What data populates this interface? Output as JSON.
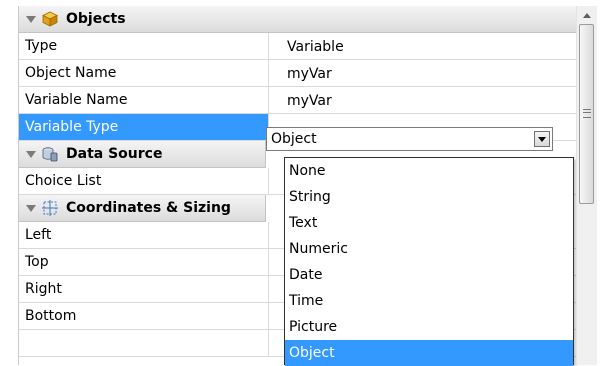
{
  "groups": {
    "objects": {
      "label": "Objects",
      "icon": "cube-icon"
    },
    "data_source": {
      "label": "Data Source",
      "icon": "database-icon"
    },
    "coordinates": {
      "label": "Coordinates & Sizing",
      "icon": "coordinates-grid-icon"
    }
  },
  "properties": {
    "type": {
      "name": "Type",
      "value": "Variable"
    },
    "object_name": {
      "name": "Object Name",
      "value": "myVar"
    },
    "variable_name": {
      "name": "Variable Name",
      "value": "myVar"
    },
    "variable_type": {
      "name": "Variable Type",
      "value": "Object"
    },
    "choice_list": {
      "name": "Choice List",
      "value": ""
    },
    "left": {
      "name": "Left",
      "value": ""
    },
    "top": {
      "name": "Top",
      "value": ""
    },
    "right": {
      "name": "Right",
      "value": ""
    },
    "bottom": {
      "name": "Bottom",
      "value": ""
    }
  },
  "dropdown": {
    "options": [
      "None",
      "String",
      "Text",
      "Numeric",
      "Date",
      "Time",
      "Picture",
      "Object"
    ],
    "selected": "Object"
  },
  "colors": {
    "selection": "#3399ff",
    "header_bg": "#e6e6e6"
  }
}
